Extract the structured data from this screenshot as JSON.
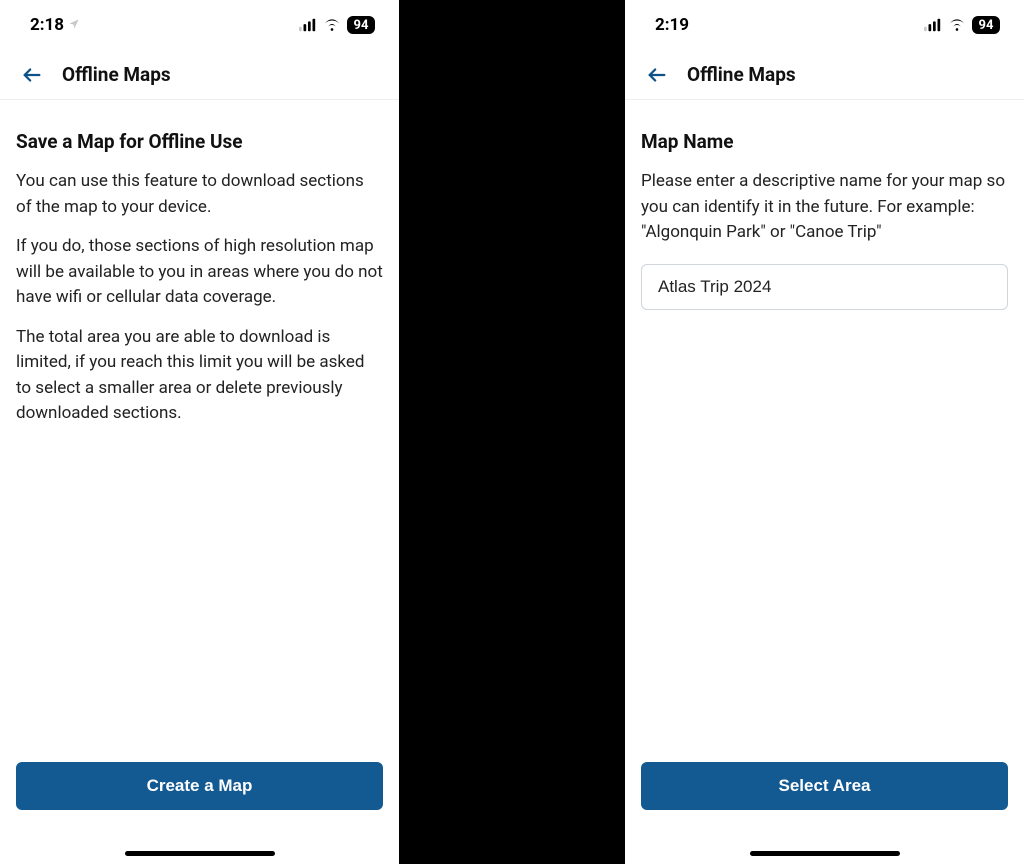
{
  "left": {
    "status": {
      "time": "2:18",
      "battery": "94"
    },
    "nav": {
      "title": "Offline Maps"
    },
    "content": {
      "heading": "Save a Map for Offline Use",
      "p1": "You can use this feature to download sections of the map to your device.",
      "p2": "If you do, those sections of high resolution map will be available to you in areas where you do not have wifi or cellular data coverage.",
      "p3": "The total area you are able to download is limited, if you reach this limit you will be asked to select a smaller area or delete previously downloaded sections."
    },
    "cta": "Create a Map"
  },
  "right": {
    "status": {
      "time": "2:19",
      "battery": "94"
    },
    "nav": {
      "title": "Offline Maps"
    },
    "content": {
      "heading": "Map Name",
      "p1": "Please enter a descriptive name for your map so you can identify it in the future. For example: \"Algonquin Park\" or \"Canoe Trip\"",
      "input_value": "Atlas Trip 2024"
    },
    "cta": "Select Area"
  }
}
